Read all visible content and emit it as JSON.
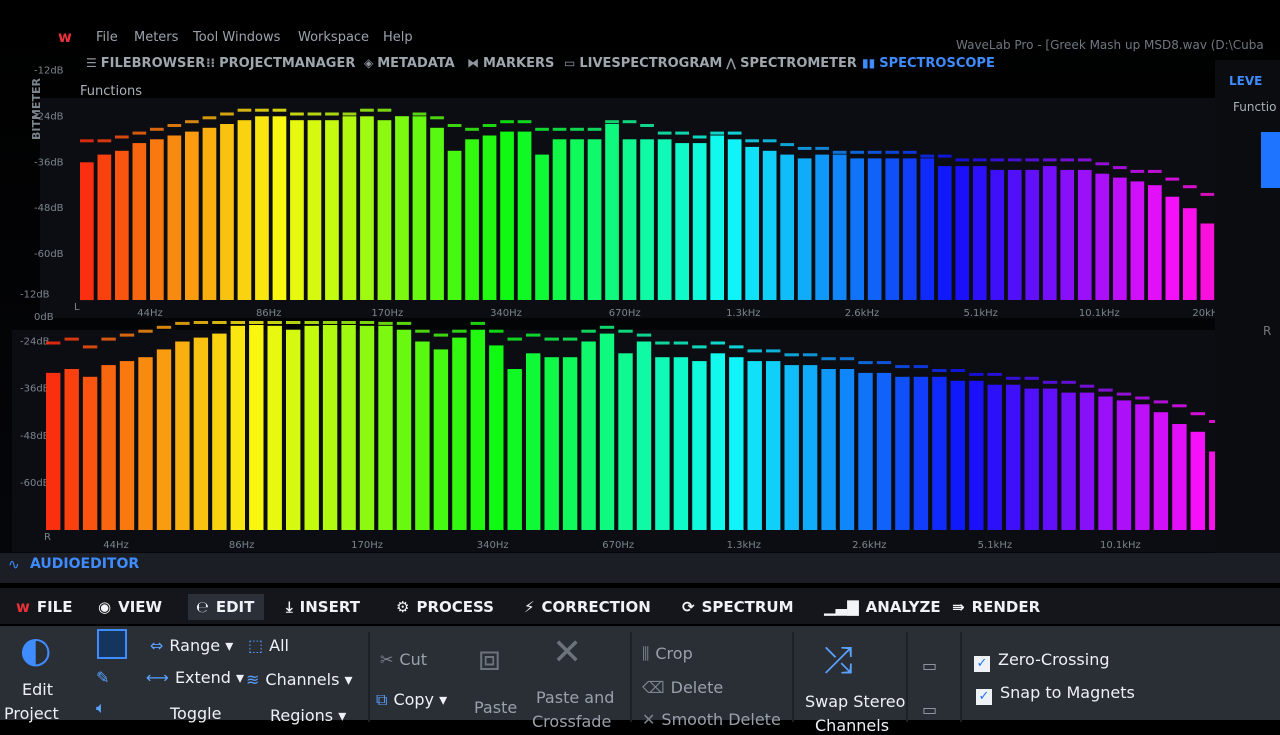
{
  "menubar": {
    "logo": "w",
    "items": [
      "File",
      "Meters",
      "Tool Windows",
      "Workspace",
      "Help"
    ],
    "window_title": "WaveLab Pro - [Greek Mash up MSD8.wav (D:\\Cuba"
  },
  "toolwindows": {
    "tabs": [
      {
        "label": "FILEBROWSER",
        "icon": "list-icon"
      },
      {
        "label": "PROJECTMANAGER",
        "icon": "grid-icon"
      },
      {
        "label": "METADATA",
        "icon": "tag-icon"
      },
      {
        "label": "MARKERS",
        "icon": "marker-icon"
      },
      {
        "label": "LIVESPECTROGRAM",
        "icon": "monitor-icon"
      },
      {
        "label": "SPECTROMETER",
        "icon": "peak-icon"
      },
      {
        "label": "SPECTROSCOPE",
        "icon": "bars-icon",
        "active": true
      }
    ],
    "functions": "Functions",
    "side_label": "BITMETER",
    "right_tab": "LEVE",
    "right_functions": "Functio",
    "right_channel": "R"
  },
  "chart_data": [
    {
      "type": "bar",
      "channel": "L",
      "db_ticks": [
        "-12dB",
        "-24dB",
        "-36dB",
        "-48dB",
        "-60dB"
      ],
      "top_db": "0dB",
      "freq_ticks": [
        "44Hz",
        "86Hz",
        "170Hz",
        "340Hz",
        "670Hz",
        "1.3kHz",
        "2.6kHz",
        "5.1kHz",
        "10.1kHz",
        "20kHz"
      ],
      "ylim": [
        -72,
        0
      ],
      "values": [
        -36,
        -34,
        -33,
        -31,
        -30,
        -29,
        -28,
        -27,
        -26,
        -25,
        -24,
        -24,
        -25,
        -25,
        -25,
        -24,
        -24,
        -25,
        -24,
        -24,
        -27,
        -33,
        -30,
        -29,
        -28,
        -28,
        -34,
        -30,
        -30,
        -30,
        -26,
        -30,
        -30,
        -30,
        -31,
        -31,
        -29,
        -30,
        -32,
        -33,
        -34,
        -35,
        -34,
        -34,
        -35,
        -35,
        -35,
        -35,
        -35,
        -37,
        -37,
        -37,
        -38,
        -38,
        -38,
        -37,
        -38,
        -38,
        -39,
        -40,
        -41,
        -42,
        -45,
        -48,
        -52
      ],
      "peaks": [
        -30,
        -30,
        -29,
        -28,
        -27,
        -26,
        -25,
        -24,
        -23,
        -22,
        -22,
        -22,
        -23,
        -23,
        -23,
        -23,
        -22,
        -22,
        -24,
        -23,
        -24,
        -26,
        -27,
        -26,
        -25,
        -25,
        -27,
        -27,
        -27,
        -27,
        -25,
        -25,
        -26,
        -28,
        -28,
        -29,
        -28,
        -28,
        -30,
        -30,
        -31,
        -32,
        -32,
        -33,
        -33,
        -33,
        -33,
        -33,
        -34,
        -34,
        -35,
        -35,
        -35,
        -35,
        -35,
        -35,
        -35,
        -35,
        -36,
        -37,
        -38,
        -38,
        -40,
        -42,
        -44
      ]
    },
    {
      "type": "bar",
      "channel": "R",
      "db_ticks": [
        "-12dB",
        "-24dB",
        "-36dB",
        "-48dB",
        "-60dB"
      ],
      "freq_ticks": [
        "44Hz",
        "86Hz",
        "170Hz",
        "340Hz",
        "670Hz",
        "1.3kHz",
        "2.6kHz",
        "5.1kHz",
        "10.1kHz",
        "20kHz"
      ],
      "ylim": [
        -72,
        0
      ],
      "values": [
        -32,
        -31,
        -33,
        -30,
        -29,
        -28,
        -26,
        -24,
        -23,
        -22,
        -20,
        -19,
        -20,
        -21,
        -20,
        -19,
        -19,
        -20,
        -20,
        -21,
        -24,
        -26,
        -23,
        -21,
        -25,
        -31,
        -27,
        -28,
        -28,
        -24,
        -22,
        -27,
        -24,
        -28,
        -28,
        -29,
        -27,
        -28,
        -29,
        -29,
        -30,
        -30,
        -31,
        -31,
        -32,
        -32,
        -33,
        -33,
        -33,
        -34,
        -34,
        -35,
        -35,
        -36,
        -36,
        -37,
        -37,
        -38,
        -39,
        -40,
        -42,
        -45,
        -47,
        -52,
        -55
      ],
      "peaks": [
        -24,
        -23,
        -25,
        -23,
        -22,
        -21,
        -20,
        -19,
        -18,
        -17,
        -17,
        -17,
        -18,
        -18,
        -18,
        -18,
        -18,
        -18,
        -19,
        -19,
        -21,
        -22,
        -21,
        -19,
        -21,
        -23,
        -22,
        -23,
        -23,
        -21,
        -20,
        -21,
        -22,
        -24,
        -24,
        -25,
        -24,
        -25,
        -26,
        -26,
        -27,
        -27,
        -28,
        -28,
        -29,
        -29,
        -30,
        -30,
        -31,
        -31,
        -32,
        -32,
        -33,
        -33,
        -34,
        -34,
        -35,
        -36,
        -37,
        -38,
        -39,
        -40,
        -42,
        -44,
        -47
      ]
    }
  ],
  "audioeditor": {
    "title": "AUDIOEDITOR",
    "icon": "waveform-icon"
  },
  "ribbon_tabs": [
    {
      "label": "FILE",
      "icon": "wavelab-logo-icon"
    },
    {
      "label": "VIEW",
      "icon": "eye-icon"
    },
    {
      "label": "EDIT",
      "icon": "edit-e-icon",
      "active": true
    },
    {
      "label": "INSERT",
      "icon": "insert-icon"
    },
    {
      "label": "PROCESS",
      "icon": "gears-icon"
    },
    {
      "label": "CORRECTION",
      "icon": "lightning-icon"
    },
    {
      "label": "SPECTRUM",
      "icon": "circle-arrows-icon"
    },
    {
      "label": "ANALYZE",
      "icon": "analyze-bars-icon"
    },
    {
      "label": "RENDER",
      "icon": "render-icon"
    }
  ],
  "ribbon": {
    "edit_project": "Edit",
    "edit_project_2": "Project",
    "range": "Range",
    "all": "All",
    "extend": "Extend",
    "channels": "Channels",
    "toggle": "Toggle",
    "regions": "Regions",
    "cut": "Cut",
    "copy": "Copy",
    "paste": "Paste",
    "paste_and": "Paste and",
    "crossfade": "Crossfade",
    "crop": "Crop",
    "delete": "Delete",
    "smooth_delete": "Smooth Delete",
    "swap_stereo": "Swap Stereo",
    "swap_stereo_2": "Channels",
    "zero_crossing": "Zero-Crossing",
    "snap_magnets": "Snap to Magnets",
    "zero_crossing_checked": true,
    "snap_magnets_checked": true
  }
}
